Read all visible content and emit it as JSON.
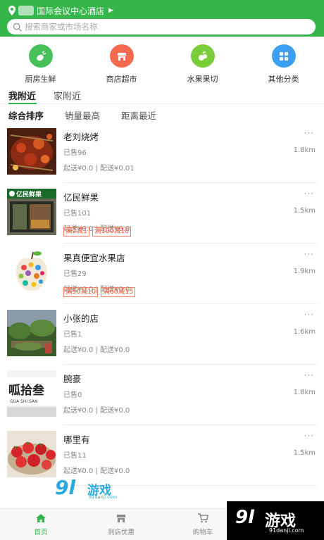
{
  "header": {
    "location": "国际会议中心酒店",
    "search_placeholder": "搜索商家或市场名称"
  },
  "categories": [
    {
      "label": "厨房生鲜",
      "color": "#47c05a",
      "icon": "vegetable-icon"
    },
    {
      "label": "商店超市",
      "color": "#f46a4e",
      "icon": "store-icon"
    },
    {
      "label": "水果果切",
      "color": "#7ccd3a",
      "icon": "fruit-icon"
    },
    {
      "label": "其他分类",
      "color": "#3d9ff0",
      "icon": "grid-icon"
    }
  ],
  "tabs": [
    "我附近",
    "家附近"
  ],
  "sorts": [
    "综合排序",
    "销量最高",
    "距离最近"
  ],
  "shops": [
    {
      "name": "老刘烧烤",
      "sold": "已售96",
      "distance": "1.8km",
      "fee": "起送¥0.0 | 配送¥0.01",
      "promos": []
    },
    {
      "name": "亿民鲜果",
      "sold": "已售101",
      "distance": "1.5km",
      "fee": "起送¥0.0 | 配送¥0.0",
      "promos": [
        "满2减1",
        "满100减10"
      ],
      "sign": "亿民鲜果"
    },
    {
      "name": "果真便宜水果店",
      "sold": "已售29",
      "distance": "1.9km",
      "fee": "起送¥0.0 | 配送¥0.0",
      "promos": [
        "满50减10",
        "满60减15"
      ]
    },
    {
      "name": "小张的店",
      "sold": "已售1",
      "distance": "1.6km",
      "fee": "起送¥0.0 | 配送¥0.0",
      "promos": []
    },
    {
      "name": "腕豪",
      "sold": "已售0",
      "distance": "1.8km",
      "fee": "起送¥0.0 | 配送¥0.0",
      "promos": [],
      "sign": "呱拾叁",
      "sign_sub": "GUA SHI SAN"
    },
    {
      "name": "哪里有",
      "sold": "已售11",
      "distance": "1.5km",
      "fee": "起送¥0.0 | 配送¥0.0",
      "promos": []
    }
  ],
  "more_glyph": "···",
  "bottom_nav": [
    {
      "label": "首页",
      "icon": "home-icon"
    },
    {
      "label": "到店优惠",
      "icon": "coupon-icon"
    },
    {
      "label": "购物车",
      "icon": "cart-icon"
    }
  ],
  "watermark": {
    "big": "9l",
    "text": "游戏",
    "url": "91danji.com"
  },
  "colors": {
    "brand": "#36b64a",
    "promo": "#f05a3c"
  }
}
